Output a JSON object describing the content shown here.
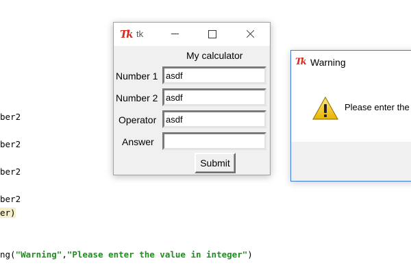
{
  "editor": {
    "lines": [
      "ber2",
      "ber2",
      "ber2",
      "ber2",
      "er)",
      "ng(",
      "\"Warning\"",
      ",",
      "\"Please enter the value in integer\"",
      ")"
    ]
  },
  "tk_window": {
    "title": "tk",
    "heading": "My calculator",
    "fields": [
      {
        "label": "Number 1",
        "value": "asdf"
      },
      {
        "label": "Number 2",
        "value": "asdf"
      },
      {
        "label": "Operator",
        "value": "asdf"
      },
      {
        "label": "Answer",
        "value": ""
      }
    ],
    "submit_label": "Submit"
  },
  "warning_dialog": {
    "title": "Warning",
    "message": "Please enter the"
  },
  "colors": {
    "string": "#1f8f1f",
    "highlight": "#f6eec8",
    "tk_logo": "#d42a1f",
    "dialog_border": "#3a7bd5"
  },
  "icons": {
    "tk_logo": "tk-feather-icon",
    "warning": "warning-triangle-icon"
  }
}
